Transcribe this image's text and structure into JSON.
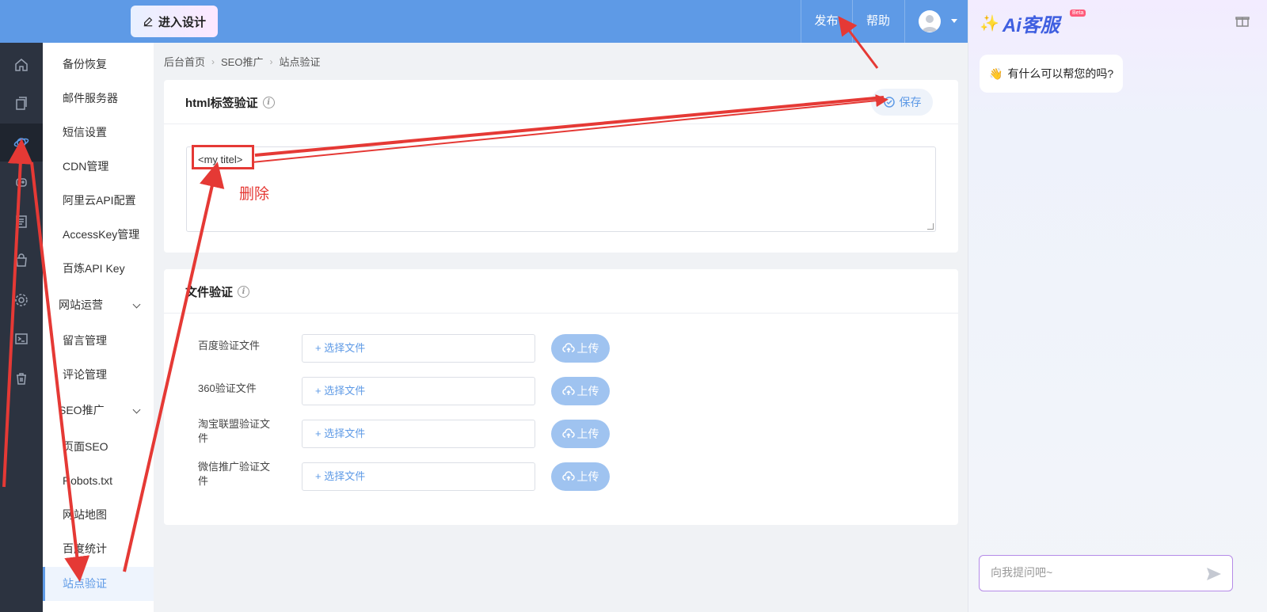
{
  "topbar": {
    "design_label": "进入设计",
    "publish_label": "发布",
    "help_label": "帮助"
  },
  "rail": {
    "icons": [
      "home-icon",
      "copy-icon",
      "planet-icon",
      "robot-icon",
      "document-icon",
      "bag-icon",
      "gear-icon",
      "terminal-icon",
      "trash-icon"
    ]
  },
  "menu": {
    "items": [
      {
        "label": "备份恢复"
      },
      {
        "label": "邮件服务器"
      },
      {
        "label": "短信设置"
      },
      {
        "label": "CDN管理"
      },
      {
        "label": "阿里云API配置"
      },
      {
        "label": "AccessKey管理"
      },
      {
        "label": "百炼API Key"
      }
    ],
    "group_ops": "网站运营",
    "ops_items": [
      {
        "label": "留言管理"
      },
      {
        "label": "评论管理"
      }
    ],
    "group_seo": "SEO推广",
    "seo_items": [
      {
        "label": "页面SEO"
      },
      {
        "label": "Robots.txt"
      },
      {
        "label": "网站地图"
      },
      {
        "label": "百度统计"
      },
      {
        "label": "站点验证"
      }
    ]
  },
  "breadcrumb": {
    "home": "后台首页",
    "parent": "SEO推广",
    "current": "站点验证"
  },
  "html_card": {
    "title": "html标签验证",
    "save_label": "保存",
    "textarea_value": "<my titel>"
  },
  "file_card": {
    "title": "文件验证",
    "rows": [
      {
        "label": "百度验证文件",
        "choose": "选择文件",
        "upload": "上传"
      },
      {
        "label": "360验证文件",
        "choose": "选择文件",
        "upload": "上传"
      },
      {
        "label": "淘宝联盟验证文件",
        "choose": "选择文件",
        "upload": "上传"
      },
      {
        "label": "微信推广验证文件",
        "choose": "选择文件",
        "upload": "上传"
      }
    ]
  },
  "ai": {
    "logo_text": "Ai客服",
    "beta": "Beta",
    "greeting": "有什么可以帮您的吗?",
    "input_placeholder": "向我提问吧~"
  },
  "annotation": {
    "delete_note": "删除"
  },
  "colors": {
    "primary": "#5e9ae6",
    "rail_bg": "#2c3340",
    "annotation_red": "#e53935"
  }
}
